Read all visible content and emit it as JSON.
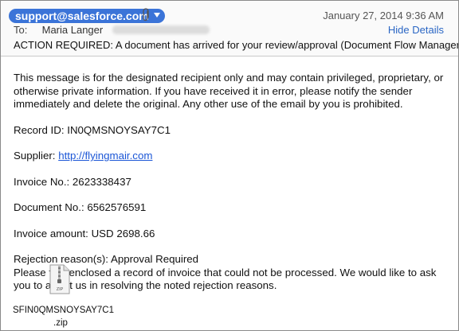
{
  "header": {
    "sender": "support@salesforce.com",
    "date": "January 27, 2014  9:36 AM",
    "to_label": "To:",
    "to_name": "Maria Langer",
    "hide_details": "Hide Details",
    "subject": "ACTION REQUIRED: A document has arrived for your review/approval (Document Flow Manager)"
  },
  "body": {
    "disclaimer": "This message is for the designated recipient only and may contain privileged, proprietary, or otherwise private information. If you have received it in error, please notify the sender immediately and delete the original. Any other use of the email by you is prohibited.",
    "record_id": "Record ID: IN0QMSNOYSAY7C1",
    "supplier_label": "Supplier: ",
    "supplier_link": "http://flyingmair.com",
    "invoice_no": "Invoice No.: 2623338437",
    "document_no": "Document No.: 6562576591",
    "invoice_amount": "Invoice amount: USD 2698.66",
    "rejection_reason": "Rejection reason(s): Approval Required",
    "request": "Please find enclosed a record of invoice that could not be processed. We would like to ask you to assist us in resolving the noted rejection reasons."
  },
  "attachment": {
    "icon_label": "ZIP",
    "name_line1": "SFIN0QMSNOYSAY7C1",
    "name_line2": ".zip"
  }
}
